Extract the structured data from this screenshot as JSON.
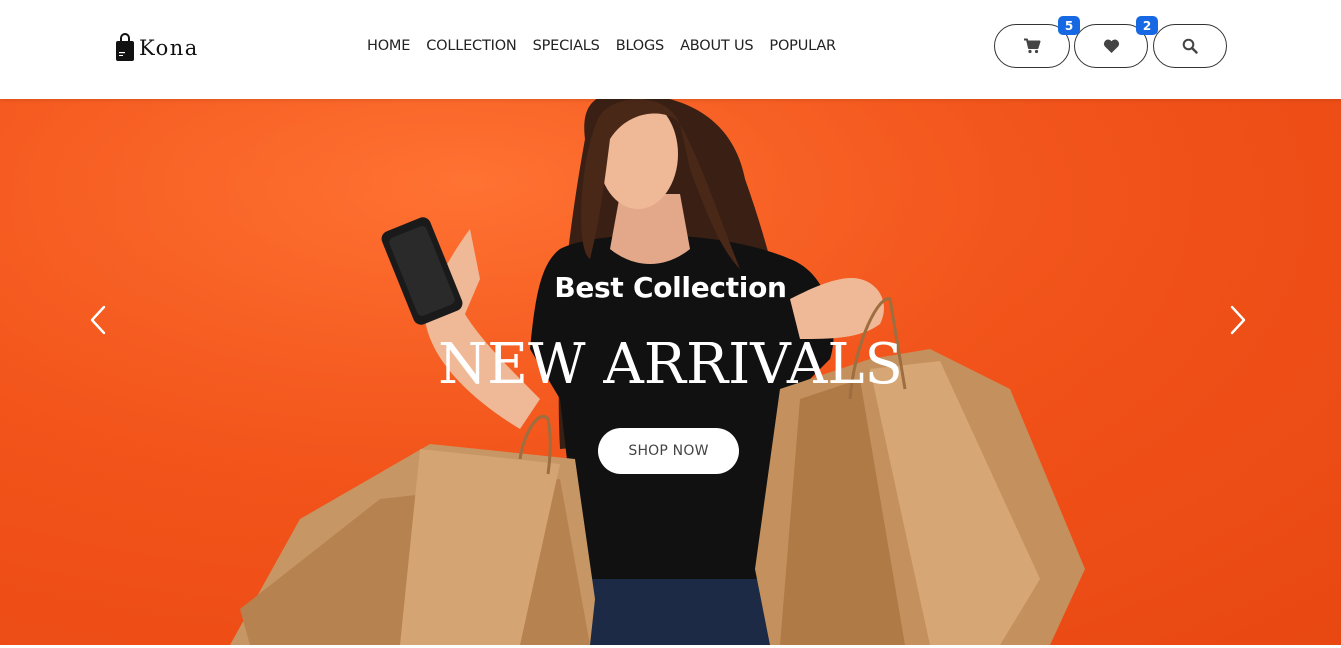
{
  "brand": {
    "name": "Kona"
  },
  "nav": {
    "items": [
      {
        "label": "HOME"
      },
      {
        "label": "COLLECTION"
      },
      {
        "label": "SPECIALS"
      },
      {
        "label": "BLOGS"
      },
      {
        "label": "ABOUT US"
      },
      {
        "label": "POPULAR"
      }
    ]
  },
  "actions": {
    "cart": {
      "icon": "cart-icon",
      "count": "5"
    },
    "wishlist": {
      "icon": "heart-icon",
      "count": "2"
    },
    "search": {
      "icon": "search-icon"
    }
  },
  "hero": {
    "subtitle": "Best Collection",
    "title": "NEW ARRIVALS",
    "button_label": "SHOP NOW",
    "prev_icon": "chevron-left-icon",
    "next_icon": "chevron-right-icon"
  },
  "colors": {
    "hero_background": "#f3541a",
    "badge": "#1668e3",
    "text_on_hero": "#ffffff"
  }
}
